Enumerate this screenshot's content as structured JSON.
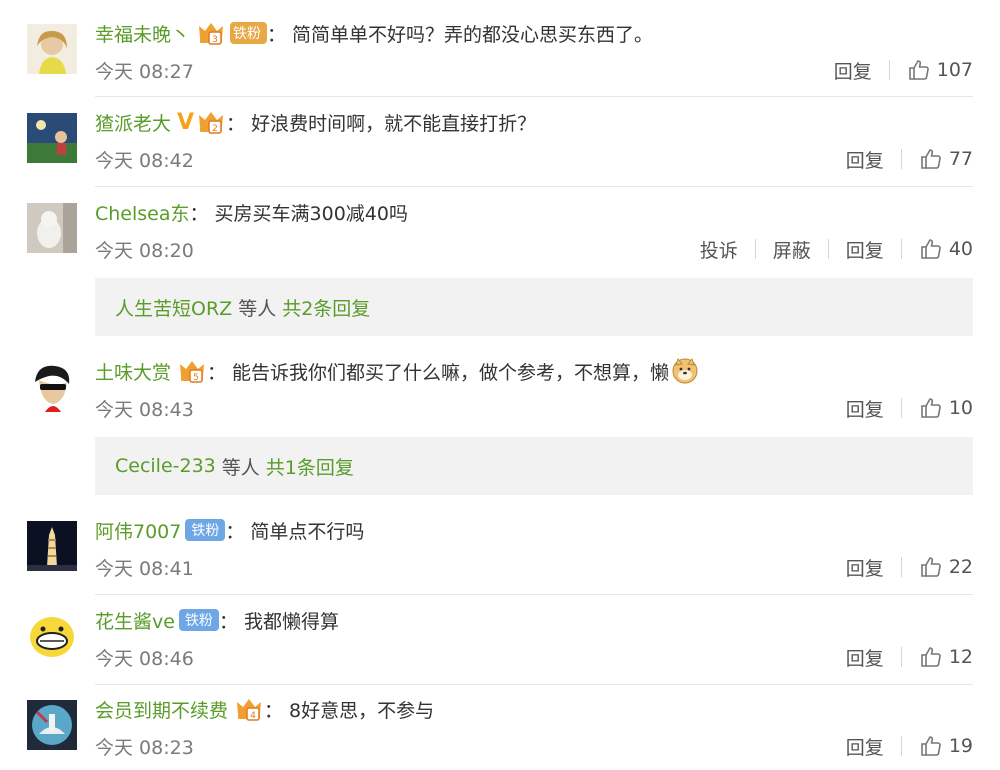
{
  "comments": [
    {
      "user": "幸福未晚丶",
      "badge": "crown-fan",
      "fan_label": "铁粉",
      "text": "简简单单不好吗？弄的都没心思买东西了。",
      "time": "今天 08:27",
      "actions": [],
      "reply_label": "回复",
      "likes": "107"
    },
    {
      "user": "猹派老大",
      "badge": "v-crown",
      "text": "好浪费时间啊，就不能直接打折？",
      "time": "今天 08:42",
      "actions": [],
      "reply_label": "回复",
      "likes": "77"
    },
    {
      "user": "Chelsea东",
      "badge": "none",
      "text": "买房买车满300减40吗",
      "time": "今天 08:20",
      "actions": [
        "投诉",
        "屏蔽"
      ],
      "reply_label": "回复",
      "likes": "40",
      "thread": {
        "name": "人生苦短ORZ",
        "deng": "等人",
        "more": "共2条回复"
      }
    },
    {
      "user": "土味大赏",
      "badge": "crown",
      "text": "能告诉我你们都买了什么嘛，做个参考，不想算，懒",
      "emoji": "doge-icon",
      "time": "今天 08:43",
      "actions": [],
      "reply_label": "回复",
      "likes": "10",
      "thread": {
        "name": "Cecile-233",
        "deng": "等人",
        "more": "共1条回复"
      }
    },
    {
      "user": "阿伟7007",
      "badge": "fan",
      "fan_label": "铁粉",
      "text": "简单点不行吗",
      "time": "今天 08:41",
      "actions": [],
      "reply_label": "回复",
      "likes": "22"
    },
    {
      "user": "花生酱ve",
      "badge": "fan",
      "fan_label": "铁粉",
      "text": "我都懒得算",
      "time": "今天 08:46",
      "actions": [],
      "reply_label": "回复",
      "likes": "12"
    },
    {
      "user": "会员到期不续费",
      "badge": "crown",
      "text": "8好意思，不参与",
      "time": "今天 08:23",
      "actions": [],
      "reply_label": "回复",
      "likes": "19"
    }
  ],
  "colors": {
    "username": "#5a9c2a",
    "time": "#7a7a7a",
    "reply_bg": "#f2f2f2",
    "fan_gold": "#e8a845",
    "fan_blue": "#6fa6e6",
    "v_mark": "#f5a31a"
  },
  "icons": {
    "like": "thumbs-up-icon",
    "crown": "crown-level-icon",
    "v": "verified-v-icon"
  }
}
